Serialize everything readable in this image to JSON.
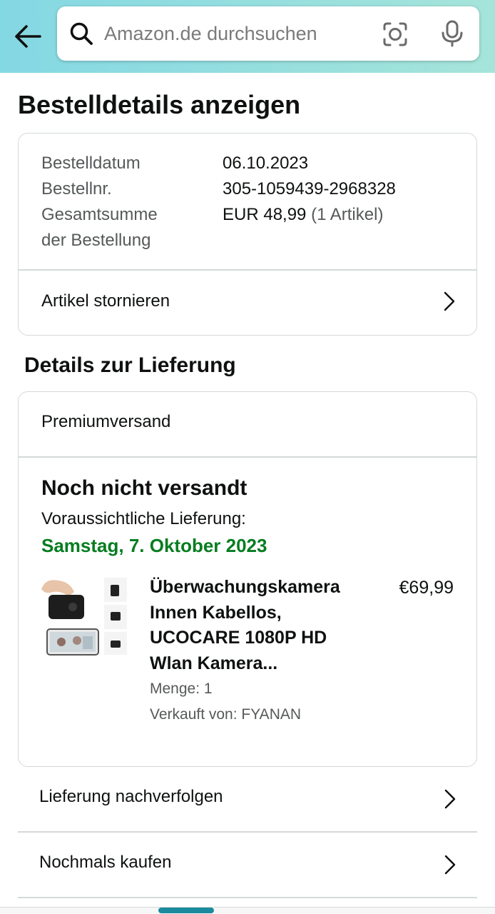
{
  "search": {
    "placeholder": "Amazon.de durchsuchen"
  },
  "page": {
    "title": "Bestelldetails anzeigen"
  },
  "order": {
    "date_label": "Bestelldatum",
    "date_value": "06.10.2023",
    "number_label": "Bestellnr.",
    "number_value": "305-1059439-2968328",
    "total_label_line1": "Gesamtsumme",
    "total_label_line2": "der Bestellung",
    "total_value": "EUR 48,99",
    "total_items": "(1 Artikel)",
    "cancel_label": "Artikel stornieren"
  },
  "delivery": {
    "section_title": "Details zur Lieferung",
    "shipping_type": "Premiumversand",
    "status": "Noch nicht versandt",
    "eta_label": "Voraussichtliche Lieferung:",
    "eta_date": "Samstag, 7. Oktober 2023",
    "item": {
      "title_line1": "Überwachungskamera",
      "title_line2": "Innen Kabellos,",
      "title_line3": "UCOCARE 1080P HD",
      "title_line4": "Wlan Kamera...",
      "price": "€69,99",
      "quantity": "Menge: 1",
      "seller": "Verkauft von: FYANAN"
    }
  },
  "actions": {
    "track": "Lieferung nachverfolgen",
    "buy_again": "Nochmals kaufen"
  },
  "colors": {
    "topbar_start": "#84d8e3",
    "topbar_end": "#a5e4da",
    "eta_green": "#067d20",
    "border": "#d5d9d9",
    "indicator": "#1c8a9e"
  },
  "icons": [
    "back-arrow-icon",
    "search-icon",
    "camera-lens-icon",
    "microphone-icon",
    "chevron-right-icon"
  ]
}
